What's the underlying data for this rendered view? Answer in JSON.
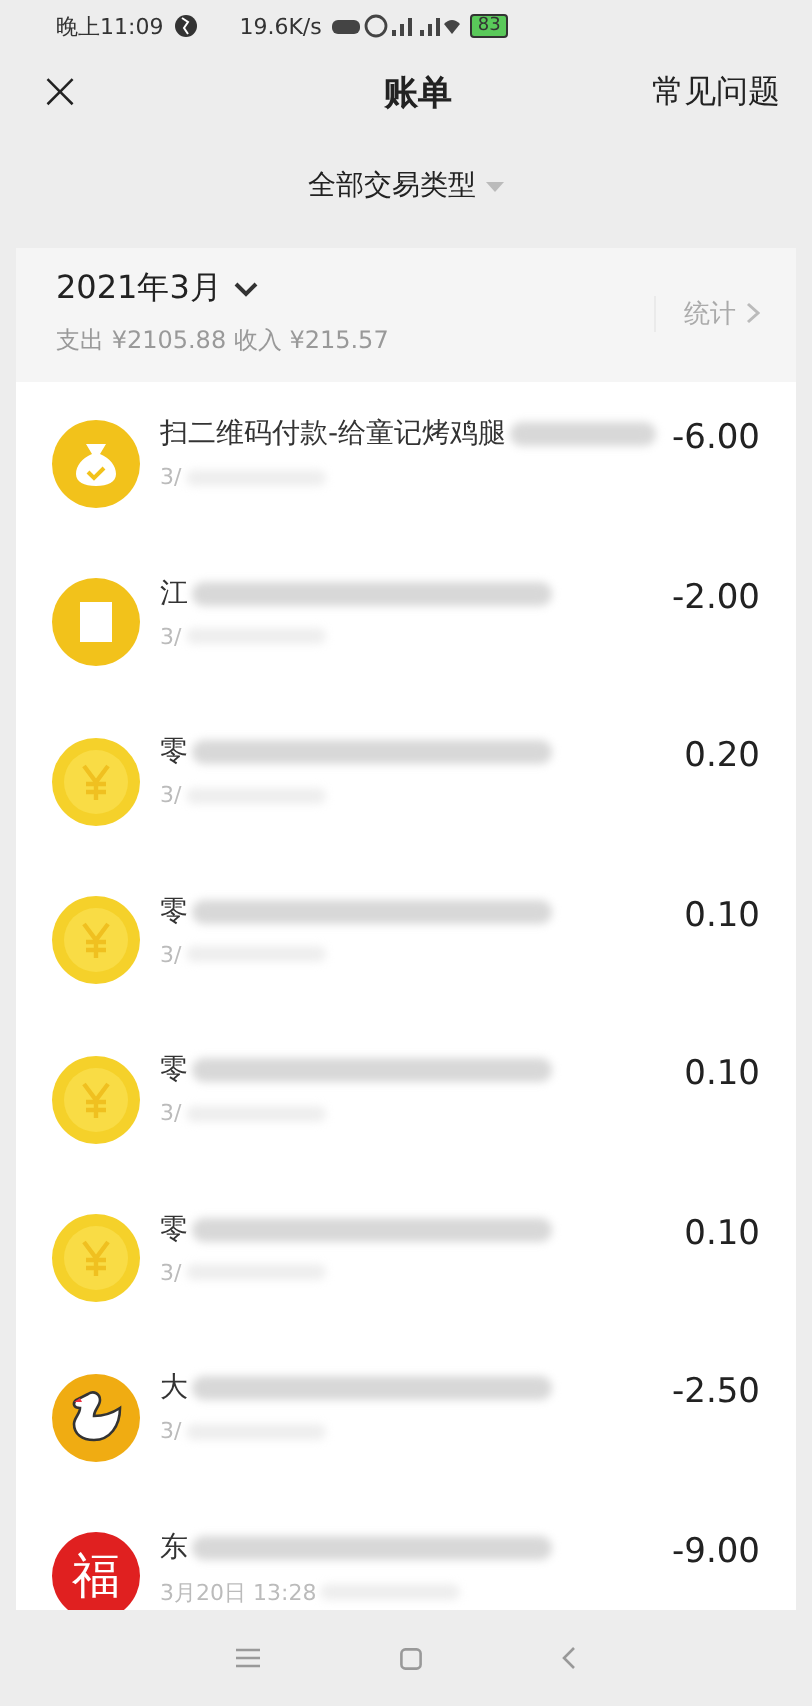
{
  "status_bar": {
    "time": "晚上11:09",
    "speed": "19.6K/s",
    "battery": "83"
  },
  "header": {
    "close": "×",
    "title": "账单",
    "help": "常见问题"
  },
  "filter": {
    "label": "全部交易类型"
  },
  "summary": {
    "month": "2021年3月",
    "totals": "支出 ¥2105.88 收入 ¥215.57",
    "stats": "统计"
  },
  "transactions": [
    {
      "kind": "bag",
      "title": "扫二维码付款-给童记烤鸡腿",
      "date": "3/",
      "amount": "-6.00"
    },
    {
      "kind": "receipt",
      "title": "江",
      "date": "3/",
      "amount": "-2.00"
    },
    {
      "kind": "coin",
      "title": "零",
      "date": "3/",
      "amount": "0.20"
    },
    {
      "kind": "coin",
      "title": "零",
      "date": "3/",
      "amount": "0.10"
    },
    {
      "kind": "coin",
      "title": "零",
      "date": "3/",
      "amount": "0.10"
    },
    {
      "kind": "coin",
      "title": "零",
      "date": "3/",
      "amount": "0.10"
    },
    {
      "kind": "duck",
      "title": "大",
      "date": "3/",
      "amount": "-2.50"
    },
    {
      "kind": "fu",
      "title": "东",
      "glyph": "福",
      "date": "3月20日 13:28",
      "amount": "-9.00"
    }
  ]
}
